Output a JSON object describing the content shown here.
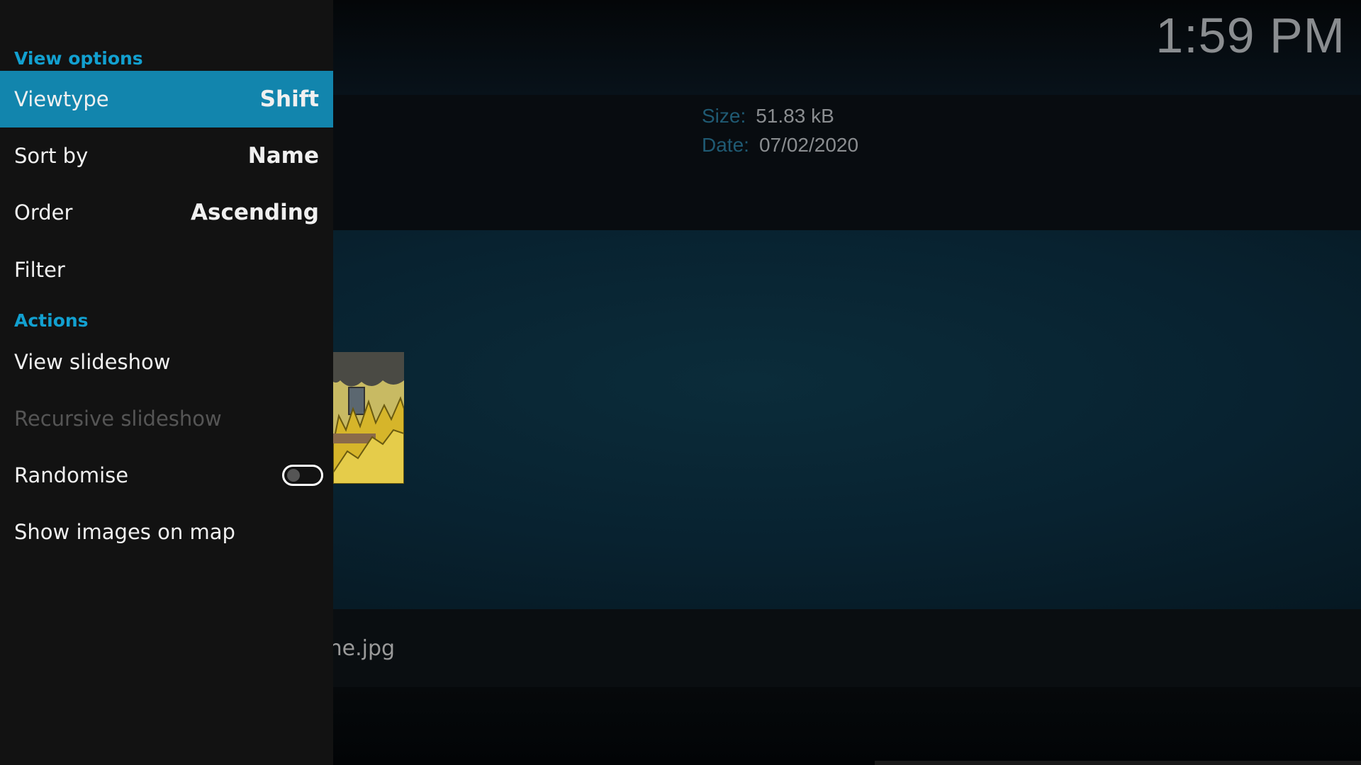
{
  "clock": "1:59 PM",
  "info": {
    "size_label": "Size:",
    "size_value": "51.83 kB",
    "date_label": "Date:",
    "date_value": "07/02/2020"
  },
  "item": {
    "filename": "this_is_fine.jpg"
  },
  "panel": {
    "view_options_header": "View options",
    "viewtype": {
      "label": "Viewtype",
      "value": "Shift"
    },
    "sort_by": {
      "label": "Sort by",
      "value": "Name"
    },
    "order": {
      "label": "Order",
      "value": "Ascending"
    },
    "filter": {
      "label": "Filter"
    },
    "actions_header": "Actions",
    "view_slideshow": {
      "label": "View slideshow"
    },
    "recursive_slideshow": {
      "label": "Recursive slideshow"
    },
    "randomise": {
      "label": "Randomise",
      "enabled": false
    },
    "show_on_map": {
      "label": "Show images on map"
    }
  },
  "colors": {
    "accent": "#1285ad",
    "section": "#12a0d0",
    "panel": "#121212"
  }
}
